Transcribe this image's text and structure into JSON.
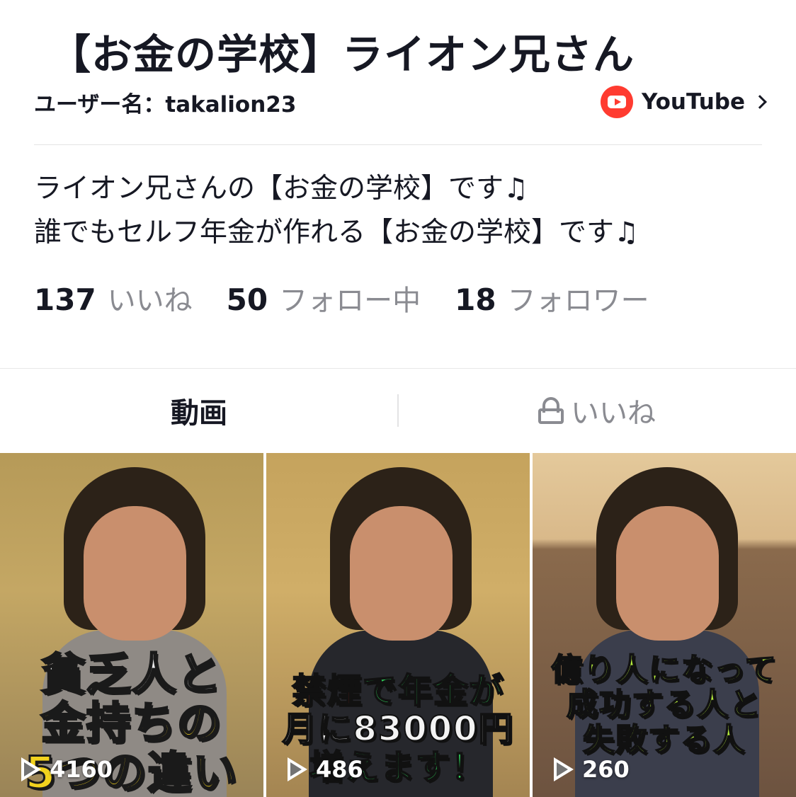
{
  "profile": {
    "title": "【お金の学校】ライオン兄さん",
    "username": "ユーザー名：takalion23",
    "youtube_label": "YouTube",
    "bio_line1": "ライオン兄さんの【お金の学校】です♫",
    "bio_line2": "誰でもセルフ年金が作れる【お金の学校】です♫"
  },
  "stats": [
    {
      "count": "137",
      "label": "いいね"
    },
    {
      "count": "50",
      "label": "フォロー中"
    },
    {
      "count": "18",
      "label": "フォロワー"
    }
  ],
  "tabs": {
    "videos": "動画",
    "likes": "いいね"
  },
  "videos": [
    {
      "line1": "貧乏人と",
      "line2": "金持ちの",
      "line3": "5つの違い",
      "plays": "4160"
    },
    {
      "line1a": "禁煙",
      "line1b": "で年金が",
      "line2": "月に83000円",
      "line3": "増えます！",
      "plays": "486"
    },
    {
      "line1": "億り人になって",
      "line2": "成功する人と",
      "line3": "失敗する人",
      "plays": "260"
    }
  ],
  "colors": {
    "accent_red": "#ff3b30",
    "text_primary": "#161823",
    "text_secondary": "#8a8b91"
  },
  "icons": [
    "youtube-icon",
    "chevron-right-icon",
    "lock-icon",
    "play-icon"
  ]
}
